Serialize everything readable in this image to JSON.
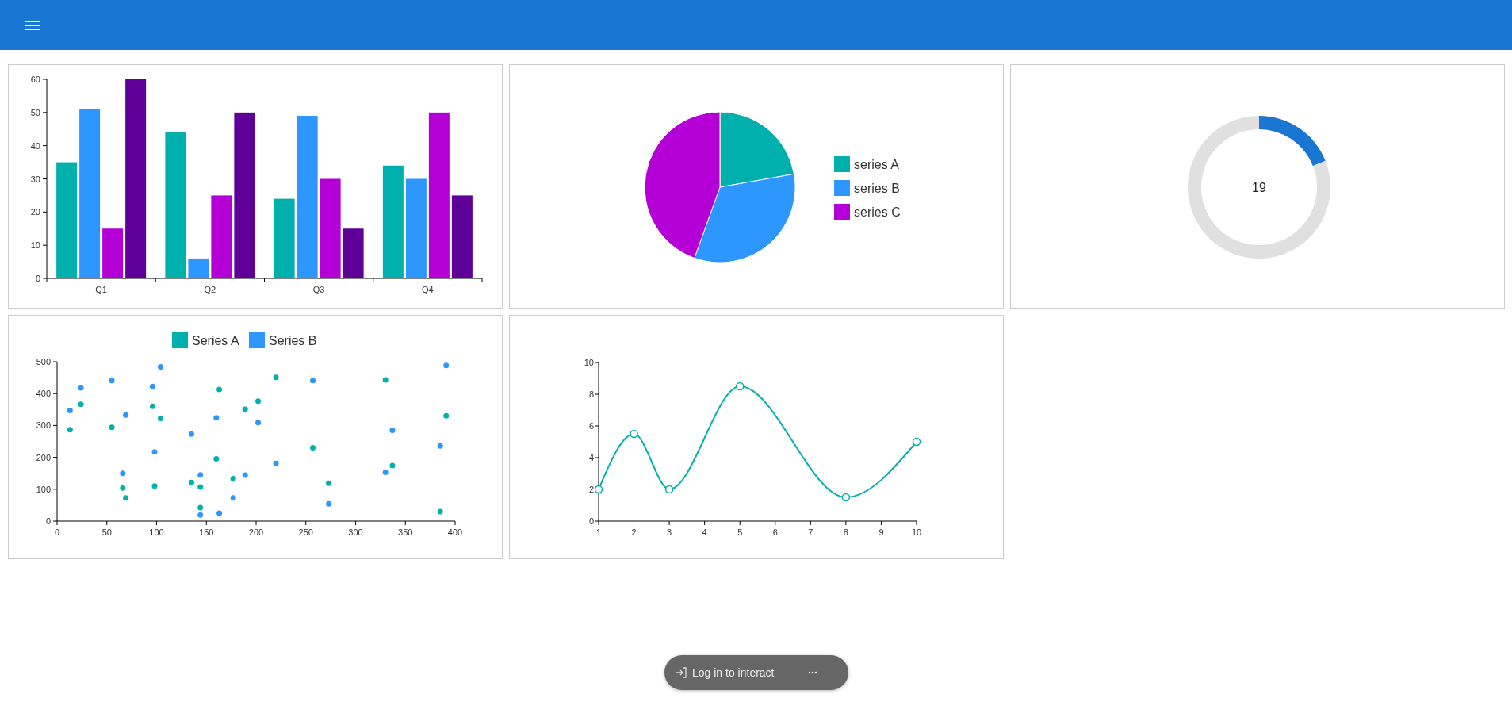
{
  "bar_chart": {
    "chart_data": {
      "type": "bar",
      "categories": [
        "Q1",
        "Q2",
        "Q3",
        "Q4"
      ],
      "ylim": [
        0,
        60
      ],
      "yticks": [
        0,
        10,
        20,
        30,
        40,
        50,
        60
      ],
      "series": [
        {
          "color": "#00b0ad",
          "values": [
            35,
            44,
            24,
            34
          ]
        },
        {
          "color": "#2d96ff",
          "values": [
            51,
            6,
            49,
            30
          ]
        },
        {
          "color": "#b400d6",
          "values": [
            15,
            25,
            30,
            50
          ]
        },
        {
          "color": "#5e0097",
          "values": [
            60,
            50,
            15,
            25
          ]
        }
      ]
    }
  },
  "pie_chart": {
    "chart_data": {
      "type": "pie",
      "categories": [
        "series A",
        "series B",
        "series C"
      ],
      "values": [
        22.2,
        33.3,
        44.5
      ],
      "legend": "right",
      "colors": [
        "#00b0ad",
        "#2d96ff",
        "#b400d6"
      ]
    }
  },
  "donut_chart": {
    "center_label": "19",
    "chart_data": {
      "type": "donut",
      "values": [
        19,
        81
      ],
      "colors": [
        "#1976d2",
        "#e0e0e0"
      ]
    }
  },
  "scatter_chart": {
    "chart_data": {
      "type": "scatter",
      "legend": "top",
      "xlim": [
        0,
        400
      ],
      "ylim": [
        0,
        500
      ],
      "xticks": [
        0,
        50,
        100,
        150,
        200,
        250,
        300,
        350,
        400
      ],
      "yticks": [
        0,
        100,
        200,
        300,
        400,
        500
      ],
      "series": [
        {
          "name": "Series A",
          "color": "#00b0ad",
          "x": [
            13,
            24,
            55,
            66,
            69,
            96,
            98,
            104,
            135,
            144,
            144,
            160,
            163,
            177,
            189,
            202,
            220,
            257,
            273,
            330,
            337,
            385,
            391
          ],
          "values": [
            287,
            366,
            294,
            104,
            73,
            360,
            110,
            322,
            121,
            107,
            42,
            195,
            413,
            133,
            351,
            376,
            451,
            230,
            119,
            443,
            174,
            30,
            330
          ]
        },
        {
          "name": "Series B",
          "color": "#2d96ff",
          "x": [
            13,
            24,
            55,
            66,
            69,
            96,
            98,
            104,
            135,
            144,
            144,
            160,
            163,
            177,
            189,
            202,
            220,
            257,
            273,
            330,
            337,
            385,
            391
          ],
          "values": [
            347,
            418,
            441,
            150,
            333,
            422,
            217,
            484,
            273,
            145,
            19,
            324,
            25,
            73,
            144,
            309,
            181,
            441,
            54,
            153,
            285,
            236,
            488
          ]
        }
      ]
    }
  },
  "line_chart": {
    "chart_data": {
      "type": "line",
      "x": [
        1,
        2,
        3,
        5,
        8,
        10
      ],
      "xlim": [
        1,
        10
      ],
      "ylim": [
        0,
        10
      ],
      "xticks": [
        1,
        2,
        3,
        4,
        5,
        6,
        7,
        8,
        9,
        10
      ],
      "yticks": [
        0,
        2,
        4,
        6,
        8,
        10
      ],
      "series": [
        {
          "color": "#00b0ad",
          "marker": "circle",
          "values": [
            2,
            5.5,
            2,
            8.5,
            1.5,
            5
          ]
        }
      ]
    }
  },
  "login_pill": {
    "label": "Log in to interact"
  }
}
